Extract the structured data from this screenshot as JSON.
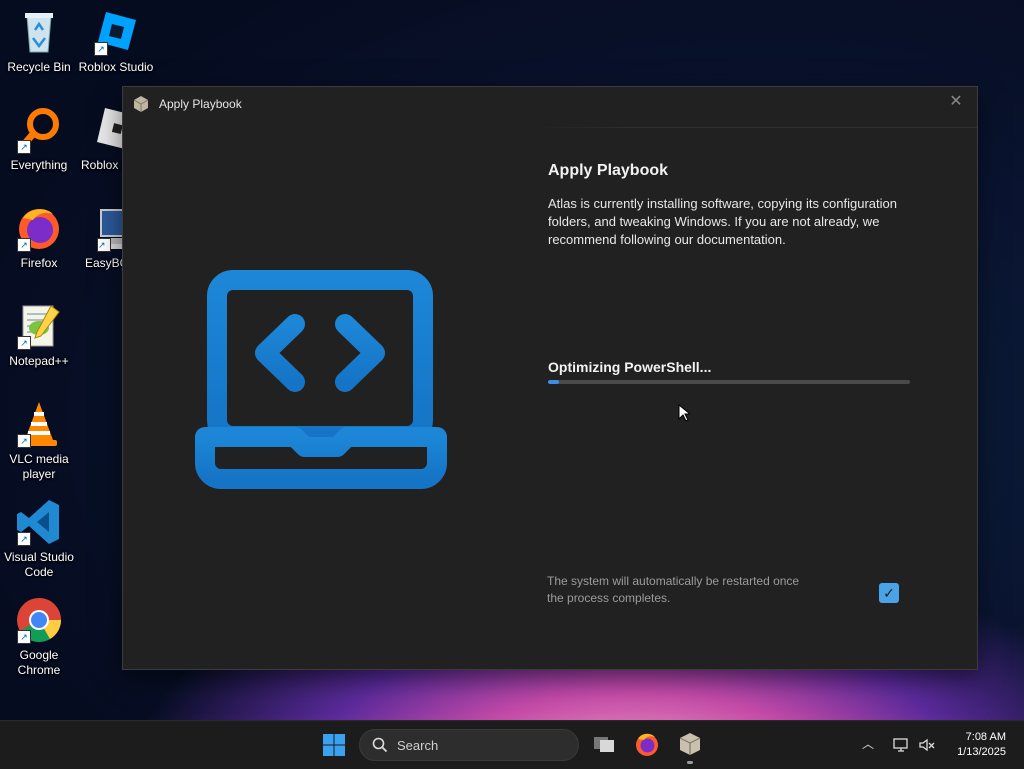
{
  "desktop": {
    "icons": [
      {
        "label": "Recycle Bin",
        "icon": "recycle-bin-icon"
      },
      {
        "label": "Roblox Studio",
        "icon": "roblox-studio-icon"
      },
      {
        "label": "Everything",
        "icon": "everything-search-icon"
      },
      {
        "label": "Roblox P",
        "icon": "roblox-player-icon"
      },
      {
        "label": "Firefox",
        "icon": "firefox-icon"
      },
      {
        "label": "EasyBC",
        "icon": "easybcd-icon"
      },
      {
        "label": "Notepad++",
        "icon": "notepad-plus-plus-icon"
      },
      {
        "label": "VLC media player",
        "icon": "vlc-icon"
      },
      {
        "label": "Visual Studio Code",
        "icon": "vscode-icon"
      },
      {
        "label": "Google Chrome",
        "icon": "chrome-icon"
      }
    ]
  },
  "window": {
    "title": "Apply Playbook",
    "close_glyph": "✕",
    "heading": "Apply Playbook",
    "description": "Atlas is currently installing software, copying its configuration folders, and tweaking Windows. If you are not already, we recommend following our documentation.",
    "progress": {
      "label": "Optimizing PowerShell...",
      "percent": 3
    },
    "restart_note": "The system will automatically be restarted once the process completes.",
    "restart_checked": true,
    "accent_color": "#1a7fd4"
  },
  "taskbar": {
    "search_placeholder": "Search",
    "apps": [
      "task-view-icon",
      "firefox-icon",
      "atlas-playbook-icon"
    ],
    "clock": {
      "time": "7:08 AM",
      "date": "1/13/2025"
    }
  }
}
